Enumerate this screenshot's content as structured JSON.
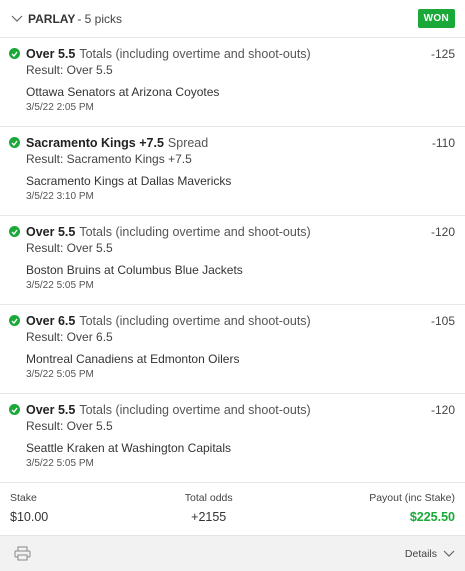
{
  "header": {
    "title": "PARLAY",
    "subtitle": "- 5 picks",
    "status_badge": "WON",
    "icons": {
      "toggle": "chevron-down-icon"
    }
  },
  "colors": {
    "accent_green": "#1aa839"
  },
  "picks": [
    {
      "selection": "Over 5.5",
      "market": "Totals (including overtime and shoot-outs)",
      "odds": "-125",
      "result": "Result: Over 5.5",
      "event": "Ottawa Senators at Arizona Coyotes",
      "time": "3/5/22 2:05 PM"
    },
    {
      "selection": "Sacramento Kings +7.5",
      "market": "Spread",
      "odds": "-110",
      "result": "Result: Sacramento Kings +7.5",
      "event": "Sacramento Kings at Dallas Mavericks",
      "time": "3/5/22 3:10 PM"
    },
    {
      "selection": "Over 5.5",
      "market": "Totals (including overtime and shoot-outs)",
      "odds": "-120",
      "result": "Result: Over 5.5",
      "event": "Boston Bruins at Columbus Blue Jackets",
      "time": "3/5/22 5:05 PM"
    },
    {
      "selection": "Over 6.5",
      "market": "Totals (including overtime and shoot-outs)",
      "odds": "-105",
      "result": "Result: Over 6.5",
      "event": "Montreal Canadiens at Edmonton Oilers",
      "time": "3/5/22 5:05 PM"
    },
    {
      "selection": "Over 5.5",
      "market": "Totals (including overtime and shoot-outs)",
      "odds": "-120",
      "result": "Result: Over 5.5",
      "event": "Seattle Kraken at Washington Capitals",
      "time": "3/5/22 5:05 PM"
    }
  ],
  "totals": {
    "stake_label": "Stake",
    "stake_value": "$10.00",
    "odds_label": "Total odds",
    "odds_value": "+2155",
    "payout_label": "Payout (inc Stake)",
    "payout_value": "$225.50"
  },
  "footer": {
    "details_label": "Details",
    "icons": {
      "print": "printer-icon",
      "details": "chevron-down-icon"
    }
  }
}
